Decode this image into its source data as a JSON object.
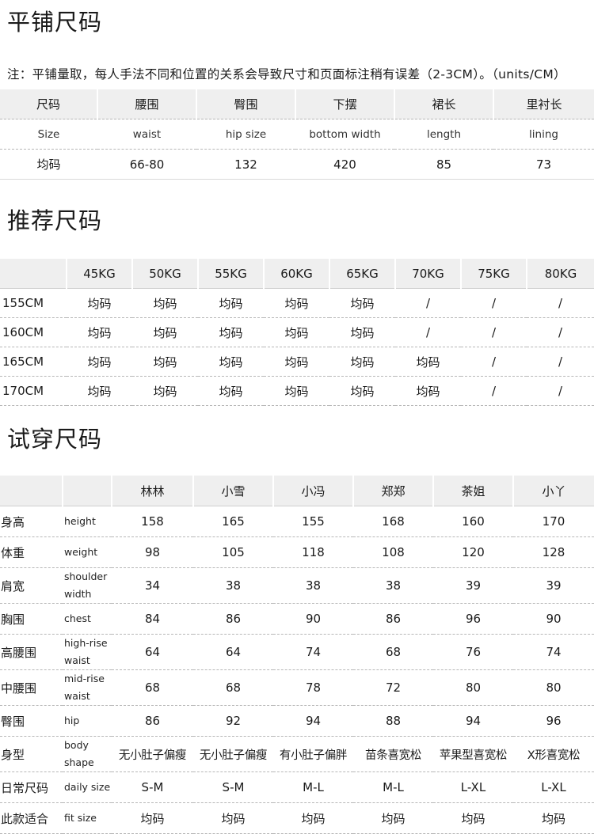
{
  "section1": {
    "title": "平铺尺码",
    "note": "注：平铺量取，每人手法不同和位置的关系会导致尺寸和页面标注稍有误差（2-3CM）。（units/CM）",
    "headers_zh": [
      "尺码",
      "腰围",
      "臀围",
      "下摆",
      "裙长",
      "里衬长"
    ],
    "headers_en": [
      "Size",
      "waist",
      "hip size",
      "bottom width",
      "length",
      "lining"
    ],
    "row": [
      "均码",
      "66-80",
      "132",
      "420",
      "85",
      "73"
    ]
  },
  "section2": {
    "title": "推荐尺码",
    "weights": [
      "45KG",
      "50KG",
      "55KG",
      "60KG",
      "65KG",
      "70KG",
      "75KG",
      "80KG"
    ],
    "rows": [
      {
        "height": "155CM",
        "values": [
          "均码",
          "均码",
          "均码",
          "均码",
          "均码",
          "/",
          "/",
          "/"
        ]
      },
      {
        "height": "160CM",
        "values": [
          "均码",
          "均码",
          "均码",
          "均码",
          "均码",
          "/",
          "/",
          "/"
        ]
      },
      {
        "height": "165CM",
        "values": [
          "均码",
          "均码",
          "均码",
          "均码",
          "均码",
          "均码",
          "/",
          "/"
        ]
      },
      {
        "height": "170CM",
        "values": [
          "均码",
          "均码",
          "均码",
          "均码",
          "均码",
          "均码",
          "/",
          "/"
        ]
      }
    ]
  },
  "section3": {
    "title": "试穿尺码",
    "models": [
      "林林",
      "小雪",
      "小冯",
      "郑郑",
      "茶姐",
      "小丫"
    ],
    "rows": [
      {
        "zh": "身高",
        "en": "height",
        "values": [
          "158",
          "165",
          "155",
          "168",
          "160",
          "170"
        ]
      },
      {
        "zh": "体重",
        "en": "weight",
        "values": [
          "98",
          "105",
          "118",
          "108",
          "120",
          "128"
        ]
      },
      {
        "zh": "肩宽",
        "en": "shoulder width",
        "values": [
          "34",
          "38",
          "38",
          "38",
          "39",
          "39"
        ]
      },
      {
        "zh": "胸围",
        "en": "chest",
        "values": [
          "84",
          "86",
          "90",
          "86",
          "96",
          "90"
        ]
      },
      {
        "zh": "高腰围",
        "en": "high-rise waist",
        "values": [
          "64",
          "64",
          "74",
          "68",
          "76",
          "74"
        ]
      },
      {
        "zh": "中腰围",
        "en": "mid-rise waist",
        "values": [
          "68",
          "68",
          "78",
          "72",
          "80",
          "80"
        ]
      },
      {
        "zh": "臀围",
        "en": "hip",
        "values": [
          "86",
          "92",
          "94",
          "88",
          "94",
          "96"
        ]
      },
      {
        "zh": "身型",
        "en": "body shape",
        "values": [
          "无小肚子偏瘦",
          "无小肚子偏瘦",
          "有小肚子偏胖",
          "苗条喜宽松",
          "苹果型喜宽松",
          "X形喜宽松"
        ]
      },
      {
        "zh": "日常尺码",
        "en": "daily size",
        "values": [
          "S-M",
          "S-M",
          "M-L",
          "M-L",
          "L-XL",
          "L-XL"
        ]
      },
      {
        "zh": "此款适合",
        "en": "fit size",
        "values": [
          "均码",
          "均码",
          "均码",
          "均码",
          "均码",
          "均码"
        ]
      }
    ]
  }
}
